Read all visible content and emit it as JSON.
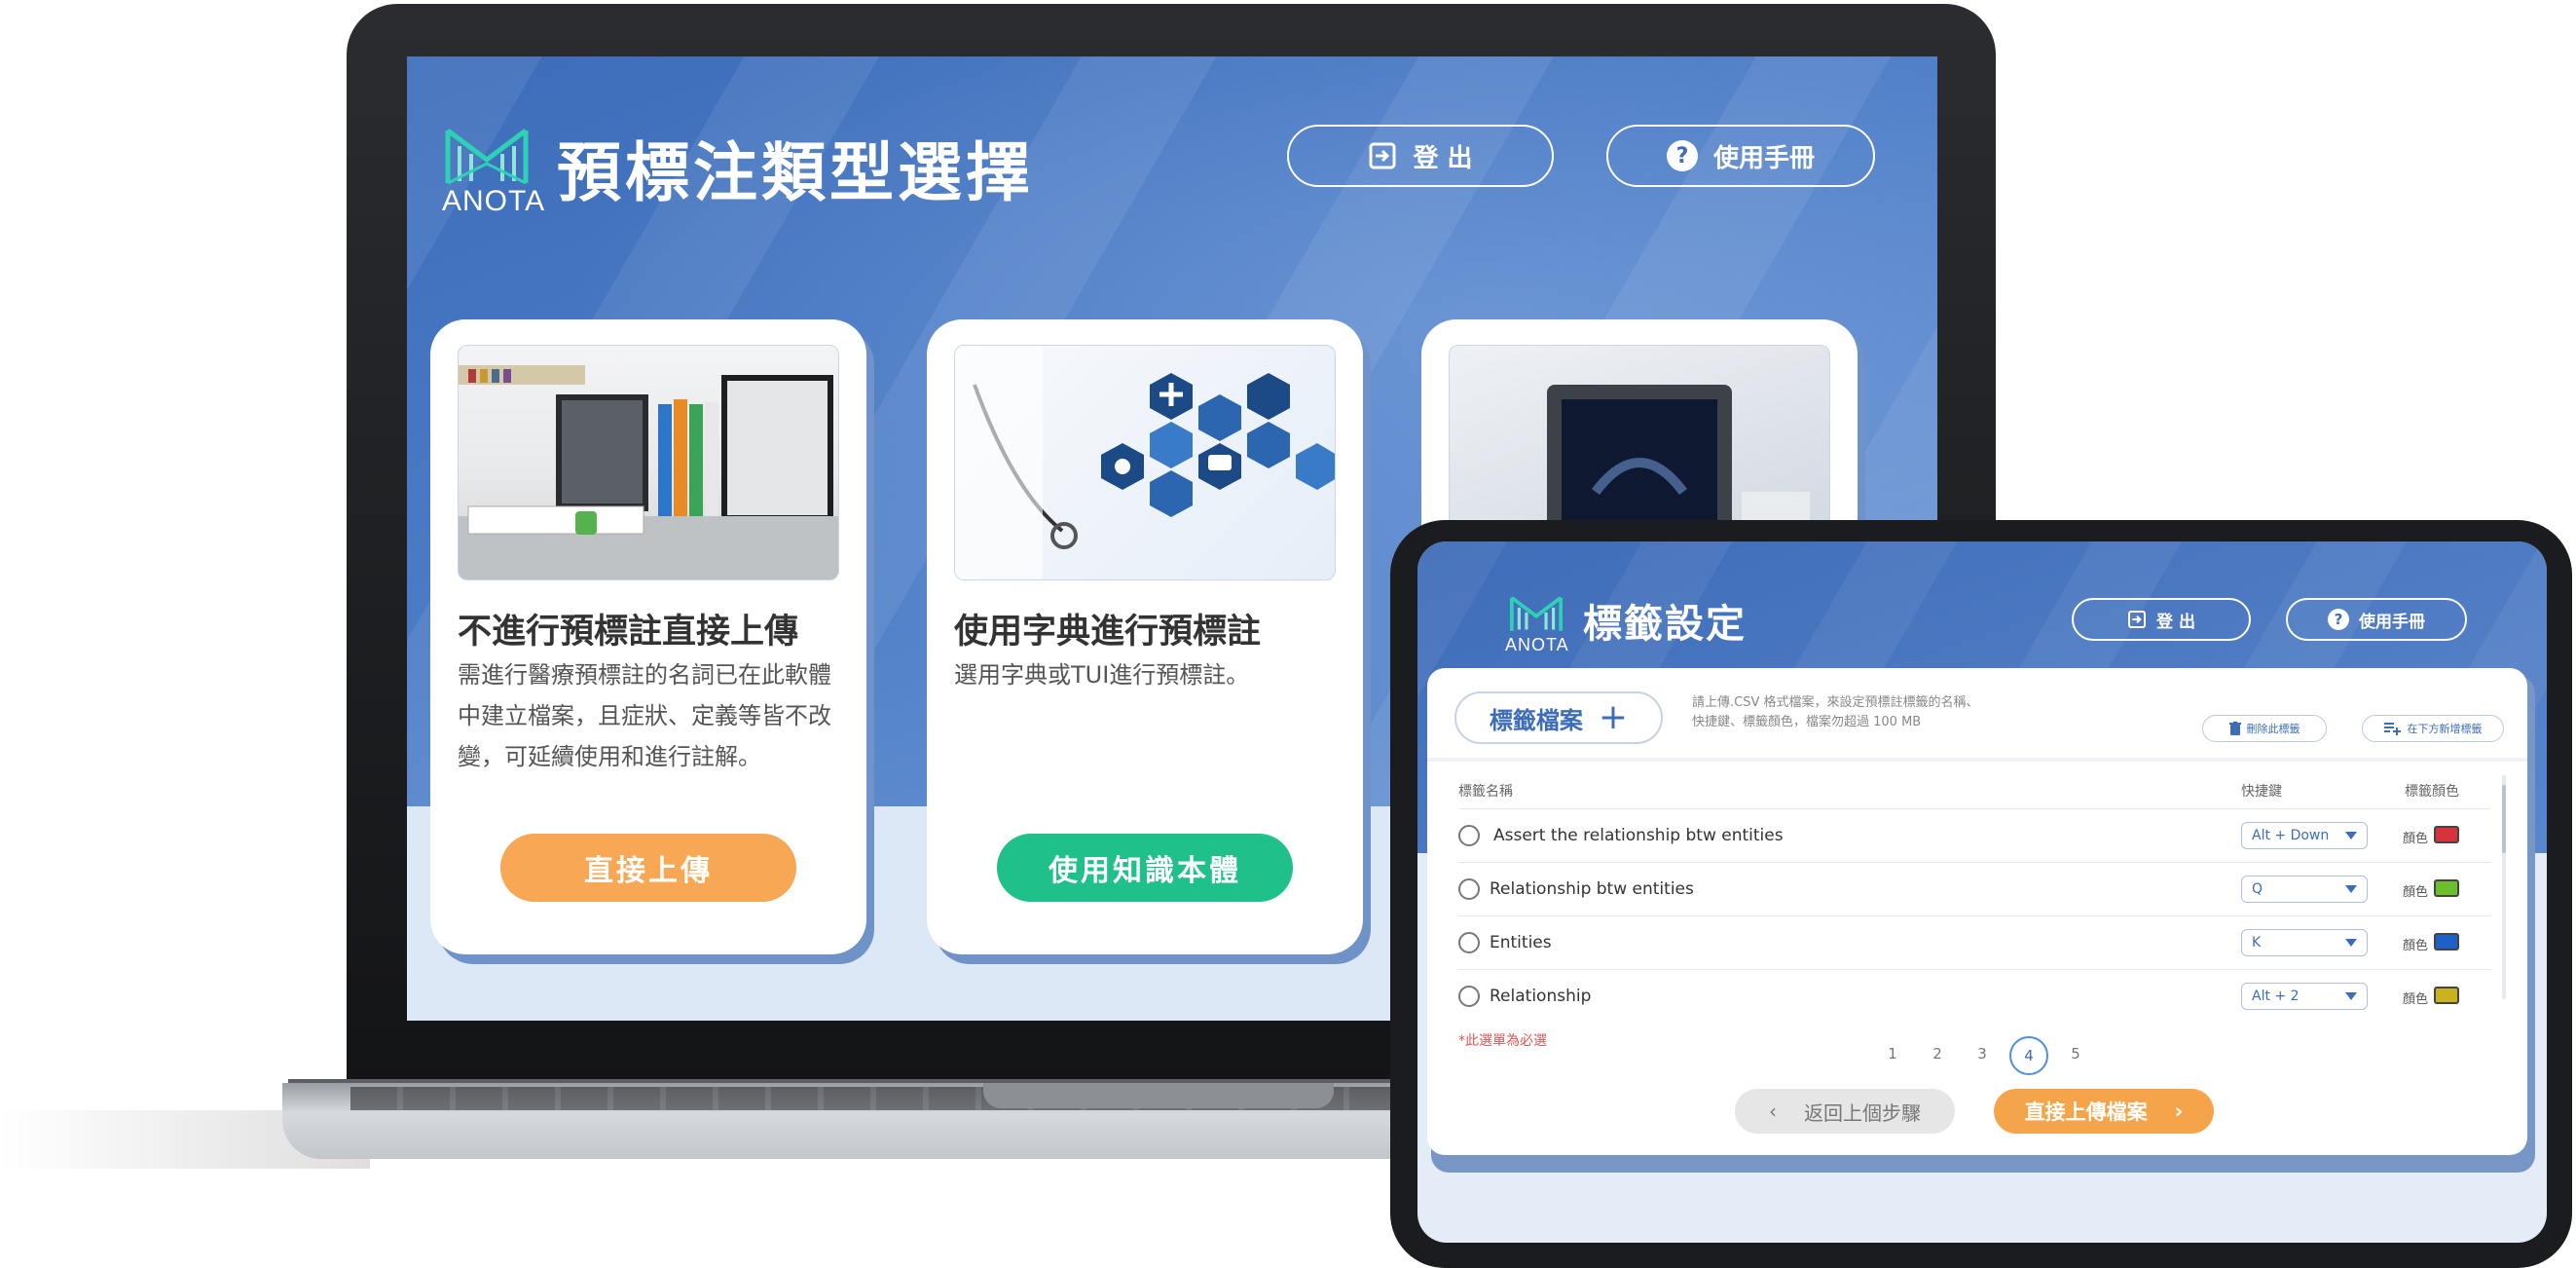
{
  "brand": {
    "logo_text": "ANOTA",
    "accent": "#2fd1b6"
  },
  "laptop": {
    "title": "預標注類型選擇",
    "logout_label": "登 出",
    "manual_label": "使用手冊",
    "cards": [
      {
        "title": "不進行預標註直接上傳",
        "desc": "需進行醫療預標註的名詞已在此軟體中建立檔案，且症狀、定義等皆不改變，可延續使用和進行註解。",
        "button": "直接上傳",
        "button_color": "#f8a755"
      },
      {
        "title": "使用字典進行預標註",
        "desc": "選用字典或TUI進行預標註。",
        "button": "使用知識本體",
        "button_color": "#1fc08a"
      },
      {
        "title": "",
        "desc": "",
        "button": "",
        "button_color": "#3d6dba"
      }
    ]
  },
  "tablet": {
    "title": "標籤設定",
    "logout_label": "登 出",
    "manual_label": "使用手冊",
    "file_button": "標籤檔案",
    "note_line1": "請上傳.CSV 格式檔案，來設定預標註標籤的名稱、",
    "note_line2": "快捷鍵、標籤顏色，檔案勿超過 100 MB",
    "delete_label": "刪除此標籤",
    "add_below_label": "在下方新增標籤",
    "col_name": "標籤名稱",
    "col_shortcut": "快捷鍵",
    "col_color": "標籤顏色",
    "color_word": "顏色",
    "rows": [
      {
        "name": "Assert the relationship btw entities",
        "shortcut": "Alt + Down",
        "color": "#d8323a"
      },
      {
        "name": "Relationship btw entities",
        "shortcut": "Q",
        "color": "#6cbf2a"
      },
      {
        "name": "Entities",
        "shortcut": "K",
        "color": "#1f5fc8"
      },
      {
        "name": "Relationship",
        "shortcut": "Alt + 2",
        "color": "#c9b21e"
      }
    ],
    "required_note": "*此選單為必選",
    "pages": [
      "1",
      "2",
      "3",
      "4",
      "5"
    ],
    "active_page": "4",
    "back_label": "返回上個步驟",
    "next_label": "直接上傳檔案"
  }
}
